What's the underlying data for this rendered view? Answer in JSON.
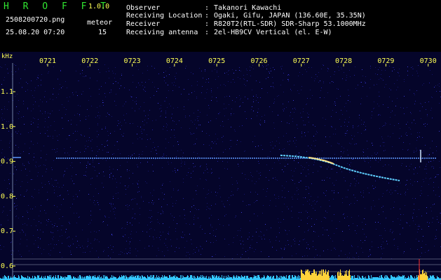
{
  "header": {
    "logo": "H R O F F T",
    "version": "1.0.0",
    "filename": "2508200720.png",
    "datetime": "25.08.20 07:20",
    "meteor_label": "meteor",
    "meteor_count": "15",
    "info": [
      {
        "label": "Observer",
        "value": "Takanori Kawachi"
      },
      {
        "label": "Receiving Location",
        "value": "Ogaki, Gifu, JAPAN (136.60E, 35.35N)"
      },
      {
        "label": "Receiver",
        "value": "R820T2(RTL-SDR) SDR-Sharp 53.1000MHz"
      },
      {
        "label": "Receiving antenna",
        "value": "2el-HB9CV Vertical (el. E-W)"
      }
    ]
  },
  "spectrogram": {
    "unit": "kHz",
    "time_ticks": [
      "0721",
      "0722",
      "0723",
      "0724",
      "0725",
      "0726",
      "0727",
      "0728",
      "0729",
      "0730"
    ],
    "freq_ticks": [
      "1.1",
      "1.0",
      "0.9",
      "0.8",
      "0.7",
      "0.6"
    ],
    "colors": {
      "noise": "#1a1a8c",
      "bg": "#05052a",
      "signal": "#ffd23a",
      "trace": "#5fd0ff",
      "label": "#ffff55"
    }
  }
}
